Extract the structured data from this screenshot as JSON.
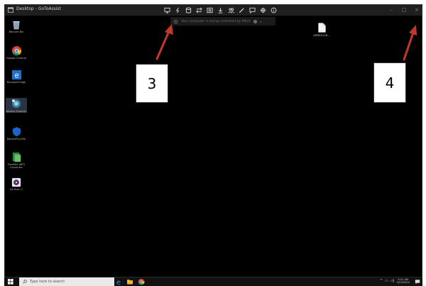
{
  "window": {
    "title": "Desktop - GoToAssist"
  },
  "toolbar": {
    "icons": [
      "monitor-icon",
      "bolt-icon",
      "database-icon",
      "swap-arrows-icon",
      "screenshot-icon",
      "download-icon",
      "users-icon",
      "pen-icon",
      "chat-icon",
      "move-icon",
      "info-icon"
    ]
  },
  "banner": {
    "text": "Your computer is being controlled by Mitch"
  },
  "desktop": {
    "icons": [
      {
        "label": "Recycle Bin",
        "icon": "recycle-bin-icon"
      },
      {
        "label": "Google Chrome",
        "icon": "chrome-icon"
      },
      {
        "label": "Microsoft Edge",
        "icon": "edge-icon"
      },
      {
        "label": "Atomix Scanner",
        "icon": "scanner-app-icon"
      },
      {
        "label": "MarkerPro DFA",
        "icon": "shield-app-icon"
      },
      {
        "label": "FreePDF WP3 Converter",
        "icon": "converter-app-icon"
      },
      {
        "label": "CD Burn 1",
        "icon": "disc-app-icon"
      }
    ],
    "file": {
      "label": "ARNS0128...",
      "icon": "document-file-icon"
    }
  },
  "taskbar": {
    "search_placeholder": "Type here to search",
    "time": "9:51 AM",
    "date": "3/23/2020"
  },
  "callouts": {
    "left": "3",
    "right": "4"
  },
  "colors": {
    "arrow": "#c0392b",
    "desktop": "#000000",
    "titlebar": "#1f1f1f"
  }
}
